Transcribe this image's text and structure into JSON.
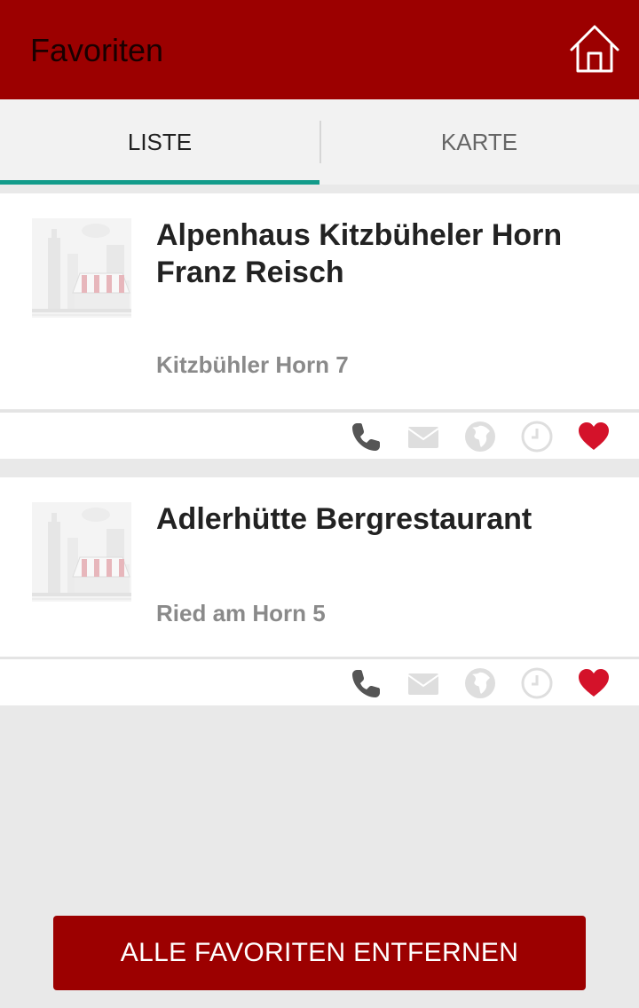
{
  "app_bar": {
    "title": "Favoriten",
    "home_icon": "home-icon",
    "color": "#9c0000"
  },
  "tabs": [
    {
      "label": "LISTE",
      "active": true
    },
    {
      "label": "KARTE",
      "active": false
    }
  ],
  "accent_color": "#129b8a",
  "favorites": [
    {
      "title_line1": "Alpenhaus Kitzbüheler Horn",
      "title_line2": "Franz Reisch",
      "address": "Kitzbühler Horn 7",
      "actions": [
        "phone-icon",
        "mail-icon",
        "globe-icon",
        "clock-icon",
        "heart-icon"
      ]
    },
    {
      "title_line1": "Adlerhütte Bergrestaurant",
      "title_line2": "",
      "address": "Ried am Horn 5",
      "actions": [
        "phone-icon",
        "mail-icon",
        "globe-icon",
        "clock-icon",
        "heart-icon"
      ]
    }
  ],
  "remove_all_label": "ALLE FAVORITEN ENTFERNEN"
}
